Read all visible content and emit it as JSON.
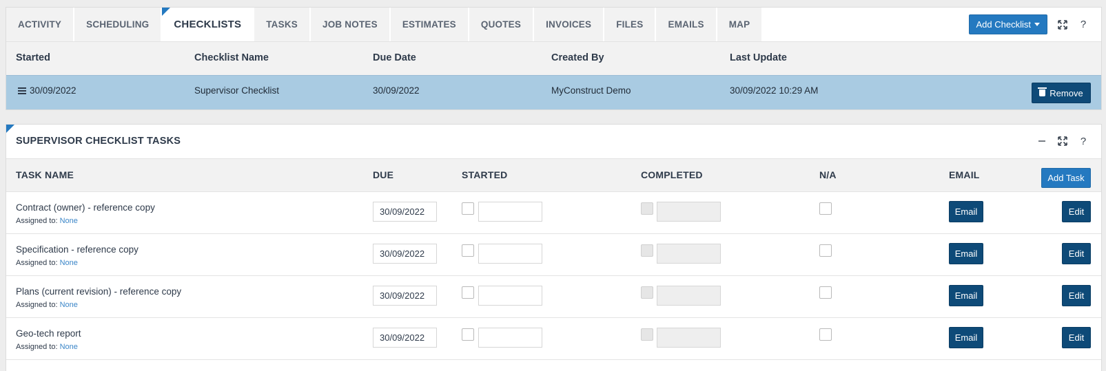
{
  "tabs": [
    {
      "label": "ACTIVITY",
      "active": false
    },
    {
      "label": "SCHEDULING",
      "active": false
    },
    {
      "label": "CHECKLISTS",
      "active": true
    },
    {
      "label": "TASKS",
      "active": false
    },
    {
      "label": "JOB NOTES",
      "active": false
    },
    {
      "label": "ESTIMATES",
      "active": false
    },
    {
      "label": "QUOTES",
      "active": false
    },
    {
      "label": "INVOICES",
      "active": false
    },
    {
      "label": "FILES",
      "active": false
    },
    {
      "label": "EMAILS",
      "active": false
    },
    {
      "label": "MAP",
      "active": false
    }
  ],
  "toolbar": {
    "add_checklist_label": "Add Checklist",
    "help": "?"
  },
  "checklists_table": {
    "columns": [
      "Started",
      "Checklist Name",
      "Due Date",
      "Created By",
      "Last Update"
    ],
    "row": {
      "started": "30/09/2022",
      "name": "Supervisor Checklist",
      "due": "30/09/2022",
      "created_by": "MyConstruct Demo",
      "last_update": "30/09/2022 10:29 AM",
      "remove_label": "Remove"
    }
  },
  "tasks_panel": {
    "title": "SUPERVISOR CHECKLIST TASKS",
    "help": "?",
    "columns": {
      "task_name": "TASK NAME",
      "due": "DUE",
      "started": "STARTED",
      "completed": "COMPLETED",
      "na": "N/A",
      "email": "EMAIL"
    },
    "add_task_label": "Add Task",
    "assigned_prefix": "Assigned to: ",
    "email_label": "Email",
    "edit_label": "Edit",
    "tasks": [
      {
        "name": "Contract (owner) - reference copy",
        "assigned": "None",
        "due": "30/09/2022"
      },
      {
        "name": "Specification - reference copy",
        "assigned": "None",
        "due": "30/09/2022"
      },
      {
        "name": "Plans (current revision) - reference copy",
        "assigned": "None",
        "due": "30/09/2022"
      },
      {
        "name": "Geo-tech report",
        "assigned": "None",
        "due": "30/09/2022"
      }
    ]
  },
  "colors": {
    "accent": "#2479c0",
    "dark_button": "#0e4a78",
    "selected_row": "#a9cbe2"
  }
}
